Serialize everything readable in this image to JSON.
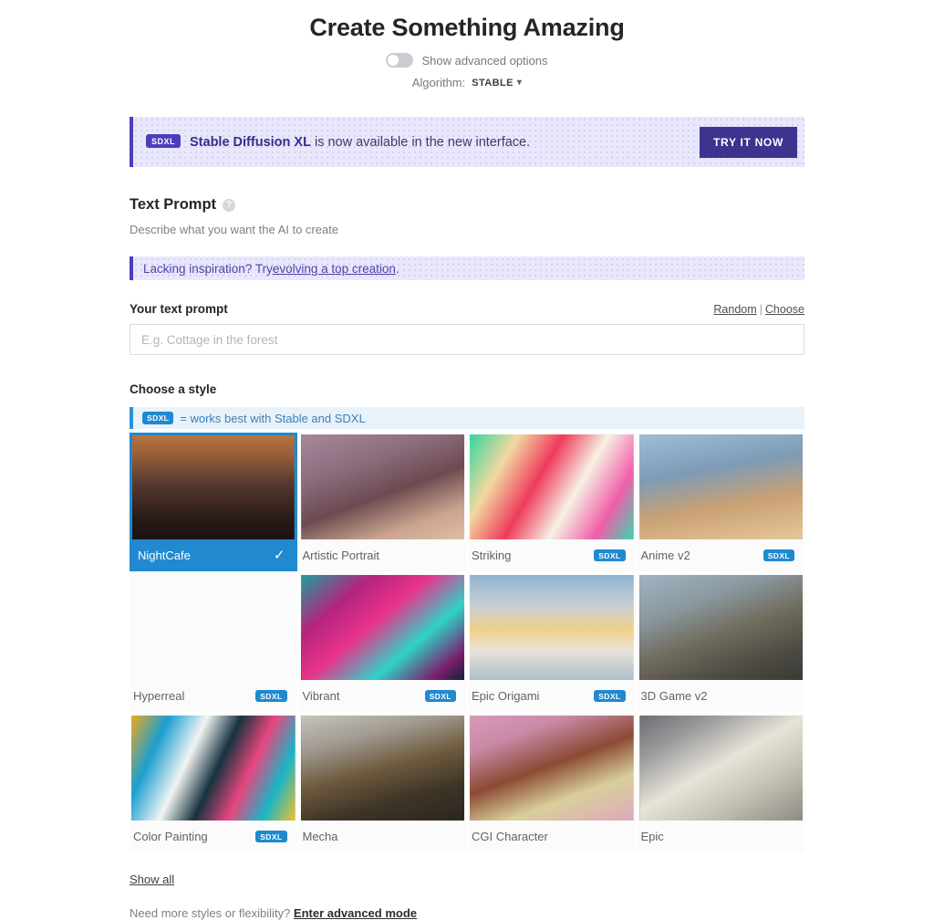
{
  "header": {
    "title": "Create Something Amazing",
    "advanced_toggle_label": "Show advanced options",
    "advanced_toggle_state": "off",
    "algorithm_label": "Algorithm:",
    "algorithm_value": "STABLE",
    "caret": "⌄"
  },
  "promo": {
    "badge": "SDXL",
    "strong_text": "Stable Diffusion XL",
    "rest_text": " is now available in the new interface.",
    "button_label": "TRY IT NOW",
    "accent_color": "#4b3fbb",
    "background_color": "#e9e7fb",
    "button_color": "#3d348f"
  },
  "text_prompt": {
    "section_title": "Text Prompt",
    "help_glyph": "?",
    "subtitle": "Describe what you want the AI to create",
    "inspiration_prefix": "Lacking inspiration? Try ",
    "inspiration_link": "evolving a top creation",
    "inspiration_suffix": ".",
    "field_label": "Your text prompt",
    "link_random": "Random",
    "link_separator": "|",
    "link_choose": "Choose",
    "input_value": "",
    "input_placeholder": "E.g. Cottage in the forest"
  },
  "styles": {
    "section_title": "Choose a style",
    "note_badge": "SDXL",
    "note_text": "= works best with Stable and SDXL",
    "note_color": "#3d7fb5",
    "note_background": "#e8f2fa",
    "badge_color": "#2089d0",
    "selected_color": "#2089d0",
    "check_glyph": "✓",
    "items": [
      {
        "label": "NightCafe",
        "badge": "",
        "selected": true
      },
      {
        "label": "Artistic Portrait",
        "badge": "",
        "selected": false
      },
      {
        "label": "Striking",
        "badge": "SDXL",
        "selected": false
      },
      {
        "label": "Anime v2",
        "badge": "SDXL",
        "selected": false
      },
      {
        "label": "Hyperreal",
        "badge": "SDXL",
        "selected": false
      },
      {
        "label": "Vibrant",
        "badge": "SDXL",
        "selected": false
      },
      {
        "label": "Epic Origami",
        "badge": "SDXL",
        "selected": false
      },
      {
        "label": "3D Game v2",
        "badge": "",
        "selected": false
      },
      {
        "label": "Color Painting",
        "badge": "SDXL",
        "selected": false
      },
      {
        "label": "Mecha",
        "badge": "",
        "selected": false
      },
      {
        "label": "CGI Character",
        "badge": "",
        "selected": false
      },
      {
        "label": "Epic",
        "badge": "",
        "selected": false
      }
    ],
    "show_all_label": "Show all"
  },
  "footer": {
    "prefix": "Need more styles or flexibility? ",
    "link": "Enter advanced mode"
  }
}
